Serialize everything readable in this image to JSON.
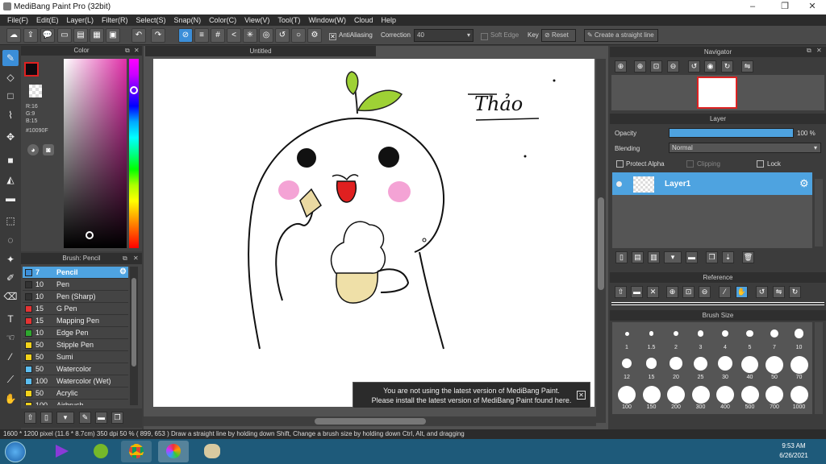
{
  "window": {
    "title": "MediBang Paint Pro (32bit)",
    "controls": [
      "–",
      "❐",
      "✕"
    ]
  },
  "menu": [
    "File(F)",
    "Edit(E)",
    "Layer(L)",
    "Filter(R)",
    "Select(S)",
    "Snap(N)",
    "Color(C)",
    "View(V)",
    "Tool(T)",
    "Window(W)",
    "Cloud",
    "Help"
  ],
  "toolbar": {
    "antialiasing_label": "AntiAliasing",
    "correction_label": "Correction",
    "correction_value": "40",
    "soft_edge_label": "Soft Edge",
    "key_label": "Key",
    "reset_label": "Reset",
    "straight_line_label": "Create a straight line"
  },
  "color_panel": {
    "title": "Color",
    "r": "R:16",
    "g": "G:9",
    "b": "B:15",
    "hex": "#10090F",
    "primary_color": "#10090f"
  },
  "brush_panel": {
    "title": "Brush: Pencil",
    "items": [
      {
        "size": "7",
        "name": "Pencil",
        "color": "#3b8ed8",
        "selected": true
      },
      {
        "size": "10",
        "name": "Pen",
        "color": "#333333"
      },
      {
        "size": "10",
        "name": "Pen (Sharp)",
        "color": "#333333"
      },
      {
        "size": "15",
        "name": "G Pen",
        "color": "#e53333"
      },
      {
        "size": "15",
        "name": "Mapping Pen",
        "color": "#e53333"
      },
      {
        "size": "10",
        "name": "Edge Pen",
        "color": "#2ea82e"
      },
      {
        "size": "50",
        "name": "Stipple Pen",
        "color": "#f2d21a"
      },
      {
        "size": "50",
        "name": "Sumi",
        "color": "#f2d21a"
      },
      {
        "size": "50",
        "name": "Watercolor",
        "color": "#5bbdf0"
      },
      {
        "size": "100",
        "name": "Watercolor (Wet)",
        "color": "#5bbdf0"
      },
      {
        "size": "50",
        "name": "Acrylic",
        "color": "#f2d21a"
      },
      {
        "size": "100",
        "name": "Airbrush",
        "color": "#f2d21a"
      }
    ]
  },
  "canvas": {
    "tab_title": "Untitled",
    "signature": "Thảo"
  },
  "navigator": {
    "title": "Navigator"
  },
  "layer_panel": {
    "title": "Layer",
    "opacity_label": "Opacity",
    "opacity_value": "100 %",
    "opacity_fraction": 1.0,
    "blending_label": "Blending",
    "blending_value": "Normal",
    "protect_alpha": "Protect Alpha",
    "clipping": "Clipping",
    "lock": "Lock",
    "layer_name": "Layer1"
  },
  "reference": {
    "title": "Reference"
  },
  "brush_size": {
    "title": "Brush Size",
    "sizes": [
      "1",
      "1.5",
      "2",
      "3",
      "4",
      "5",
      "7",
      "10",
      "12",
      "15",
      "20",
      "25",
      "30",
      "40",
      "50",
      "70",
      "100",
      "150",
      "200",
      "300",
      "400",
      "500",
      "700",
      "1000"
    ]
  },
  "notification": {
    "line1": "You are not using the latest version of MediBang Paint.",
    "line2": "Please install the latest version of MediBang Paint found here."
  },
  "status": {
    "text": "1600 * 1200 pixel   (11.6 * 8.7cm)   350 dpi   50 %   ( 899, 653 )   Draw a straight line by holding down Shift, Change a brush size by holding down Ctrl, Alt, and dragging"
  },
  "taskbar": {
    "time": "9:53 AM",
    "date": "6/26/2021"
  }
}
